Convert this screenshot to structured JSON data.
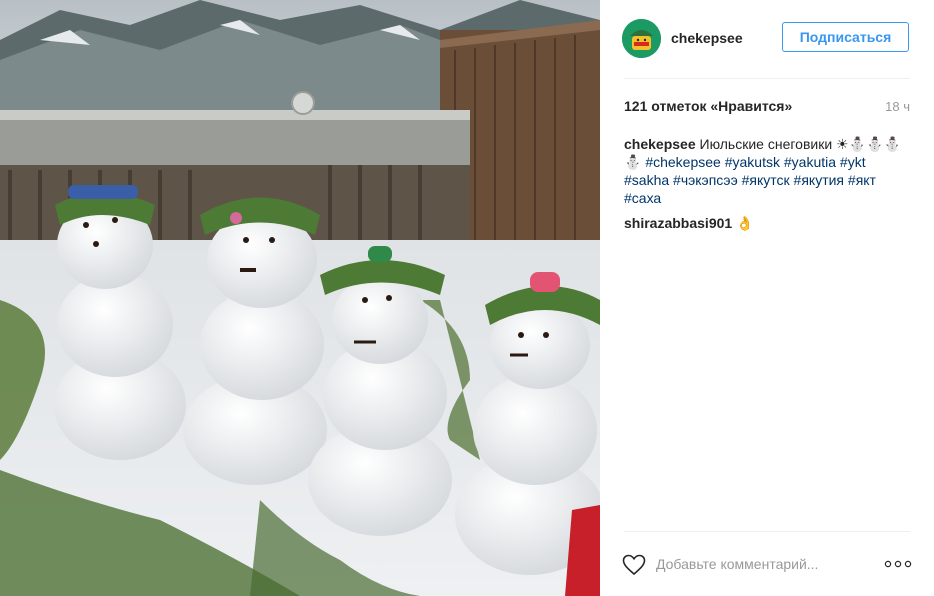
{
  "post": {
    "username": "chekepsee",
    "follow_label": "Подписаться",
    "likes_text": "121 отметок «Нравится»",
    "time_ago": "18 ч",
    "caption": {
      "username": "chekepsee",
      "text": "Июльские снеговики ☀⛄⛄⛄⛄",
      "hashtags": [
        "#chekepsee",
        "#yakutsk",
        "#yakutia",
        "#ykt",
        "#sakha",
        "#чэкэпсээ",
        "#якутск",
        "#якутия",
        "#якт",
        "#саха"
      ]
    },
    "comments": [
      {
        "username": "shirazabbasi901",
        "text": "👌"
      }
    ],
    "comment_placeholder": "Добавьте комментарий...",
    "icons": {
      "like": "heart-icon",
      "more": "more-options-icon"
    }
  },
  "colors": {
    "accent": "#3897f0",
    "hashtag": "#003569",
    "avatar_bg": "#1b9a63"
  }
}
